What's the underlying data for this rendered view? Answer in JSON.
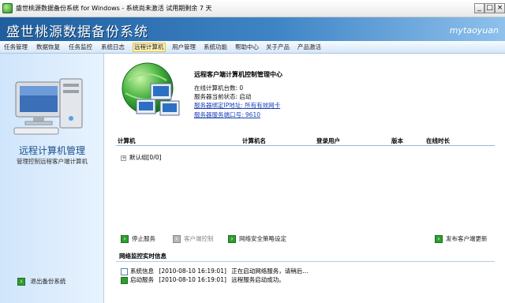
{
  "window": {
    "title": "盛世桃源数据备份系统 for Windows - 系统尚未激活 试用期剩余 7 天",
    "min_label": "_",
    "max_label": "□",
    "close_label": "×"
  },
  "banner": {
    "title": "盛世桃源数据备份系统",
    "brand": "mytaoyuan"
  },
  "menu": {
    "items": [
      {
        "label": "任务管理",
        "active": false
      },
      {
        "label": "数据恢复",
        "active": false
      },
      {
        "label": "任务监控",
        "active": false
      },
      {
        "label": "系统日志",
        "active": false
      },
      {
        "label": "远程计算机",
        "active": true
      },
      {
        "label": "用户管理",
        "active": false
      },
      {
        "label": "系统功能",
        "active": false
      },
      {
        "label": "帮助中心",
        "active": false
      },
      {
        "label": "关于产品",
        "active": false
      },
      {
        "label": "产品激活",
        "active": false
      }
    ]
  },
  "sidebar": {
    "title": "远程计算机管理",
    "subtitle": "管理控制远程客户端计算机",
    "exit_label": "退出备份系统"
  },
  "info": {
    "title": "远程客户端计算机控制管理中心",
    "online_count": "在线计算机台数: 0",
    "server_state": "服务器当前状态: 启动",
    "bind_address": "服务器绑定IP地址: 所有有效网卡",
    "server_port": "服务器服务端口号: 9610"
  },
  "table": {
    "columns": [
      "计算机",
      "计算机名",
      "登录用户",
      "版本",
      "在线时长"
    ],
    "group": {
      "expander": "+",
      "label": "默认组[0/0]"
    }
  },
  "actions": {
    "stop_service": "停止服务",
    "client_control": "客户端控制",
    "security_policy": "网络安全策略设定",
    "publish_update": "发布客户端更新"
  },
  "log": {
    "title": "网络监控实时信息",
    "entries": [
      {
        "type": "系统信息",
        "time": "[2010-08-10 16:19:01]",
        "message": "正在启动网络服务，请稍后..."
      },
      {
        "type": "启动服务",
        "time": "[2010-08-10 16:19:01]",
        "message": "远程服务启动成功。"
      }
    ]
  },
  "colors": {
    "banner": "#2f73b8",
    "sidebar": "#d8eafc",
    "accent_green": "#2f9e2f",
    "link": "#1a3fb5"
  }
}
